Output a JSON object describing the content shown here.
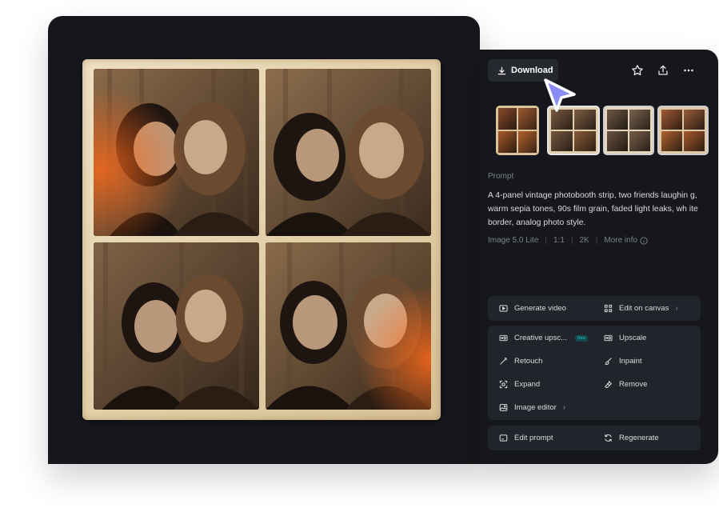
{
  "toolbar": {
    "download_label": "Download",
    "icons": [
      "download-icon",
      "star-icon",
      "share-icon",
      "more-icon"
    ]
  },
  "prompt": {
    "heading": "Prompt",
    "text": "A 4-panel vintage photobooth strip, two friends laughin g, warm sepia tones, 90s film grain, faded light leaks, wh ite border, analog photo style."
  },
  "meta": {
    "model": "Image 5.0 Lite",
    "ratio": "1:1",
    "resolution": "2K",
    "more_info": "More info"
  },
  "actions": {
    "generate_video": "Generate video",
    "edit_on_canvas": "Edit on canvas",
    "creative_upscale": "Creative upsc...",
    "creative_badge": "New",
    "upscale": "Upscale",
    "retouch": "Retouch",
    "inpaint": "Inpaint",
    "expand": "Expand",
    "remove": "Remove",
    "image_editor": "Image editor",
    "edit_prompt": "Edit prompt",
    "regenerate": "Regenerate"
  },
  "colors": {
    "background": "#15171c",
    "group": "#22242b",
    "cursor": "#8a8cf5",
    "sepia": "#e2cfa8"
  }
}
